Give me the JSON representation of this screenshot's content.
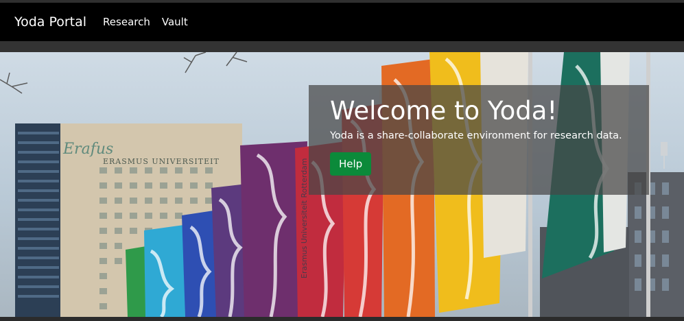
{
  "navbar": {
    "brand": "Yoda Portal",
    "links": [
      "Research",
      "Vault"
    ]
  },
  "hero": {
    "background_image": "photo of Erasmus University building with colorful flags",
    "building_sign": "ERASMUS UNIVERSITEIT",
    "logo_script": "Erafus",
    "flag_text": "Erasmus Universiteit Rotterdam",
    "title": "Welcome to Yoda!",
    "subtitle": "Yoda is a share-collaborate environment for research data.",
    "help_label": "Help"
  },
  "colors": {
    "navbar_bg": "#000000",
    "help_button": "#0b8a3a",
    "jumbotron_overlay": "rgba(70,70,70,0.72)"
  }
}
